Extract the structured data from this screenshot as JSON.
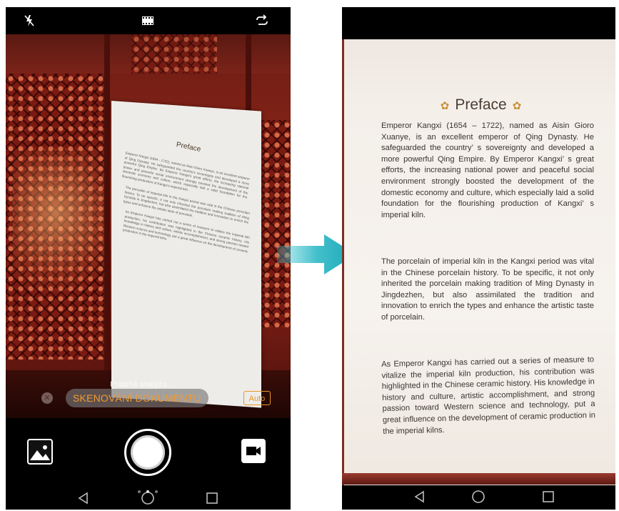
{
  "left_phone": {
    "top_bar": {
      "left_icon": "flash-off-icon",
      "center_icon": "film-strip-icon",
      "right_icon": "switch-camera-icon"
    },
    "viewfinder": {
      "document_title": "Preface",
      "document_lines": [
        "Emperor Kangxi (1654 - 1722), named as Aisin Gioro Xuanye, is an excellent emperor of Qing Dynasty. He safeguarded the country's sovereignty and developed a more powerful Qing Empire. By Emperor Kangxi's great efforts, the increasing national power and peaceful social environment strongly boosted the development of the domestic economy and culture, which especially laid a solid foundation for the flourishing production of Kangxi's imperial kiln.",
        "The porcelain of imperial kiln in the Kangxi period was vital in the Chinese porcelain history. To be specific, it not only inherited the porcelain making tradition of Ming Dynasty in Jingdezhen, but also assimilated the tradition and innovation to enrich the types and enhance the artistic taste of porcelain.",
        "As Emperor Kangxi has carried out a series of measure to vitalize the imperial kiln production, his contribution was highlighted in the Chinese ceramic history. His knowledge in history and culture, artistic accomplishment, and strong passion toward Western science and technology, put a great influence on the development of ceramic production in the imperial kilns."
      ],
      "analysis_status": "Probíhá analýza..."
    },
    "mode_bar": {
      "close_icon": "close-icon",
      "mode_label": "SKENOVÁNÍ DOKUMENTU",
      "auto_label": "Auto"
    },
    "controls": {
      "gallery_icon": "gallery-thumbnail-icon",
      "shutter_icon": "shutter-button",
      "video_icon": "video-camera-icon",
      "page_dots": 3,
      "active_dot": 1
    },
    "nav": [
      "back-icon",
      "home-icon",
      "recents-icon"
    ]
  },
  "transition_arrow": "arrow-right-icon",
  "right_phone": {
    "title": "Preface",
    "paragraphs": [
      "Emperor Kangxi (1654 – 1722), named as Aisin Gioro Xuanye, is an excellent emperor of Qing Dynasty. He safeguarded the country’ s sovereignty and developed a more powerful Qing Empire. By Emperor Kangxi’ s great efforts, the increasing national power and peaceful social environment strongly boosted the development of the domestic economy and culture, which especially laid a solid foundation for the flourishing production of Kangxi’ s imperial kiln.",
      "The porcelain of imperial kiln in the Kangxi period was vital in the Chinese porcelain history. To be specific, it not only inherited the porcelain making tradition of Ming Dynasty in Jingdezhen, but also assimilated the tradition and innovation to enrich the types and enhance the artistic taste of porcelain.",
      "As Emperor Kangxi has carried out a series of measure to vitalize the imperial kiln production, his contribution was highlighted in the Chinese ceramic history. His knowledge in history and culture, artistic accomplishment, and strong passion toward Western science and technology, put a great influence on the development of ceramic production in the imperial kilns."
    ],
    "nav": [
      "back-icon",
      "home-icon",
      "recents-icon"
    ]
  },
  "colors": {
    "accent_orange": "#f29a2e",
    "wood_red": "#7a1d14",
    "paper": "#f4efe9"
  }
}
